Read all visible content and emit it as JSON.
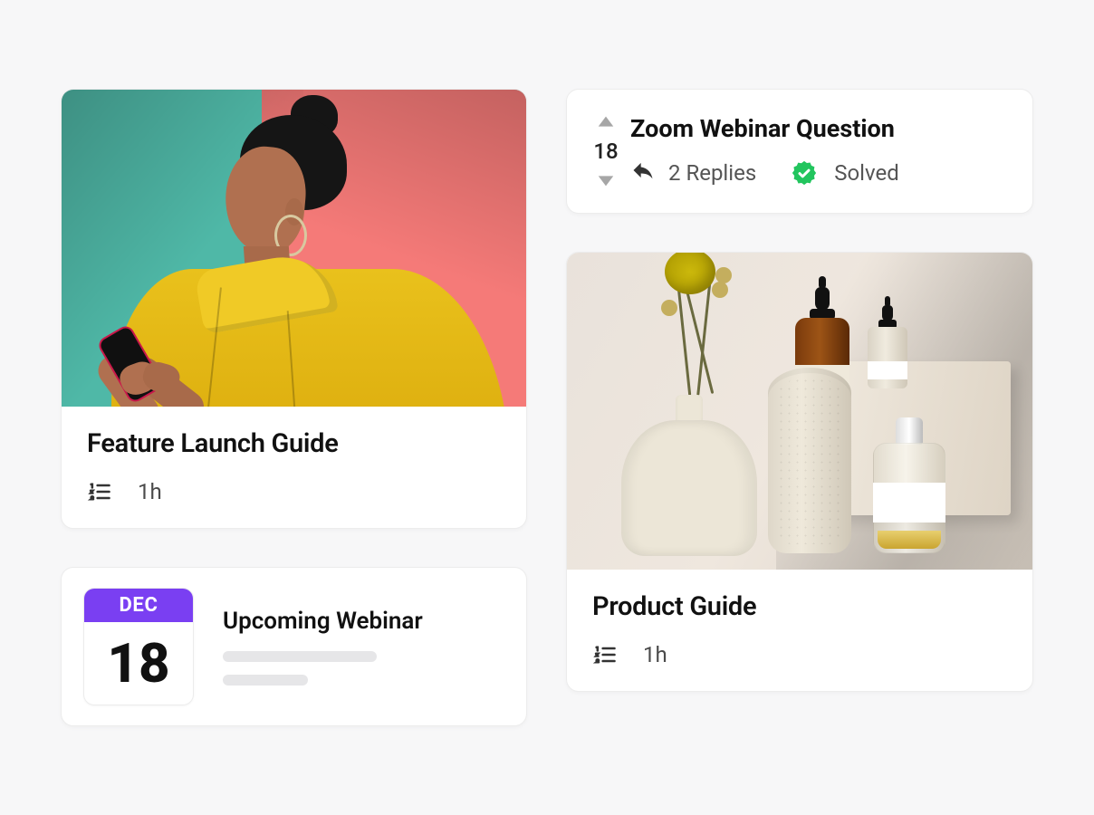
{
  "cards": {
    "feature_guide": {
      "title": "Feature Launch Guide",
      "duration": "1h"
    },
    "event": {
      "month": "DEC",
      "day": "18",
      "title": "Upcoming Webinar"
    },
    "forum": {
      "votes": "18",
      "title": "Zoom Webinar Question",
      "replies": "2 Replies",
      "status": "Solved"
    },
    "product_guide": {
      "title": "Product Guide",
      "duration": "1h"
    }
  },
  "colors": {
    "accent_purple": "#7a3ff2",
    "success_green": "#22c55e"
  }
}
